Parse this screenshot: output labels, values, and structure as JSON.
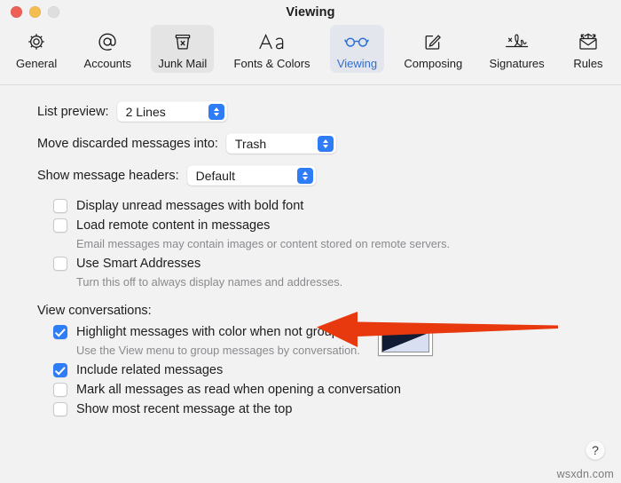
{
  "window": {
    "title": "Viewing",
    "controls": [
      {
        "name": "close-button",
        "color": "#ee5f56"
      },
      {
        "name": "minimize-button",
        "color": "#f5bd4f"
      },
      {
        "name": "zoom-button",
        "color": "#dedede"
      }
    ]
  },
  "toolbar": {
    "items": [
      {
        "id": "general",
        "label": "General",
        "icon": "gear-icon",
        "state": "normal"
      },
      {
        "id": "accounts",
        "label": "Accounts",
        "icon": "at-sign-icon",
        "state": "normal"
      },
      {
        "id": "junk-mail",
        "label": "Junk Mail",
        "icon": "junk-bin-icon",
        "state": "hovered"
      },
      {
        "id": "fonts-colors",
        "label": "Fonts & Colors",
        "icon": "aa-text-icon",
        "state": "normal"
      },
      {
        "id": "viewing",
        "label": "Viewing",
        "icon": "glasses-icon",
        "state": "selected"
      },
      {
        "id": "composing",
        "label": "Composing",
        "icon": "compose-icon",
        "state": "normal"
      },
      {
        "id": "signatures",
        "label": "Signatures",
        "icon": "signature-icon",
        "state": "normal"
      },
      {
        "id": "rules",
        "label": "Rules",
        "icon": "rules-mail-icon",
        "state": "normal"
      }
    ],
    "accent_color": "#2f6fd0",
    "selected_background": "#e3e7ed",
    "hover_background": "#e4e4e4"
  },
  "settings": {
    "list_preview": {
      "label": "List preview:",
      "value": "2 Lines"
    },
    "move_discarded": {
      "label": "Move discarded messages into:",
      "value": "Trash"
    },
    "show_headers": {
      "label": "Show message headers:",
      "value": "Default"
    }
  },
  "options": [
    {
      "id": "bold-unread",
      "label": "Display unread messages with bold font",
      "checked": false,
      "help": ""
    },
    {
      "id": "load-remote-content",
      "label": "Load remote content in messages",
      "checked": false,
      "help": "Email messages may contain images or content stored on remote servers."
    },
    {
      "id": "smart-addresses",
      "label": "Use Smart Addresses",
      "checked": false,
      "help": "Turn this off to always display names and addresses."
    }
  ],
  "conversations": {
    "section_label": "View conversations:",
    "items": [
      {
        "id": "highlight-color",
        "label": "Highlight messages with color when not grouped",
        "checked": true,
        "help": "Use the View menu to group messages by conversation.",
        "has_swatch": true
      },
      {
        "id": "include-related",
        "label": "Include related messages",
        "checked": true,
        "help": ""
      },
      {
        "id": "mark-all-read",
        "label": "Mark all messages as read when opening a conversation",
        "checked": false,
        "help": ""
      },
      {
        "id": "recent-at-top",
        "label": "Show most recent message at the top",
        "checked": false,
        "help": ""
      }
    ],
    "swatch_colors": {
      "dark": "#101c34",
      "light": "#d7dff0"
    }
  },
  "annotation": {
    "arrow_color": "#e8380d",
    "points_to": "Load remote content in messages"
  },
  "footer": {
    "help_label": "?",
    "watermark": "wsxdn.com"
  }
}
